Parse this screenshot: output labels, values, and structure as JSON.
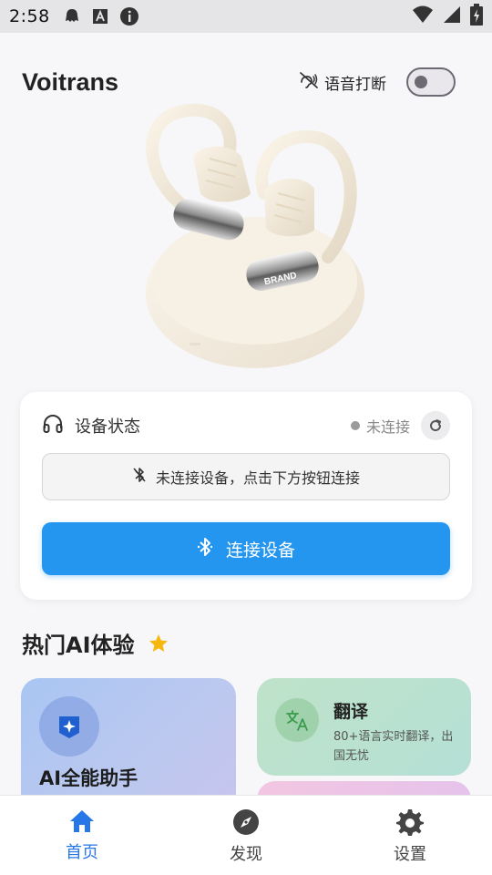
{
  "status_bar": {
    "time": "2:58",
    "left_icons": [
      "ghost-icon",
      "a-badge-icon",
      "info-icon"
    ],
    "right_icons": [
      "wifi-icon",
      "signal-icon",
      "battery-charging-icon"
    ]
  },
  "header": {
    "title": "Voitrans",
    "voice_interrupt_label": "语音打断",
    "voice_interrupt_icon": "voice-off-icon",
    "voice_interrupt_enabled": false
  },
  "product_image": {
    "brand_text": "BRAND"
  },
  "device_card": {
    "title": "设备状态",
    "title_icon": "headphones-icon",
    "status_text": "未连接",
    "status_color": "#9a9a9a",
    "refresh_icon": "refresh-icon",
    "notice_text": "未连接设备，点击下方按钮连接",
    "notice_icon": "bluetooth-off-icon",
    "connect_label": "连接设备",
    "connect_icon": "bluetooth-icon",
    "accent_color": "#2596f0"
  },
  "section": {
    "title": "热门AI体验",
    "icon": "star-icon",
    "icon_color": "#f6b80e"
  },
  "features": [
    {
      "title": "AI全能助手",
      "icon": "sparkle-icon"
    },
    {
      "title": "翻译",
      "description": "80+语言实时翻译，出国无忧",
      "icon": "translate-icon"
    }
  ],
  "bottom_nav": {
    "items": [
      {
        "label": "首页",
        "icon": "home-icon",
        "active": true
      },
      {
        "label": "发现",
        "icon": "compass-icon",
        "active": false
      },
      {
        "label": "设置",
        "icon": "gear-icon",
        "active": false
      }
    ],
    "active_color": "#2877e8"
  }
}
